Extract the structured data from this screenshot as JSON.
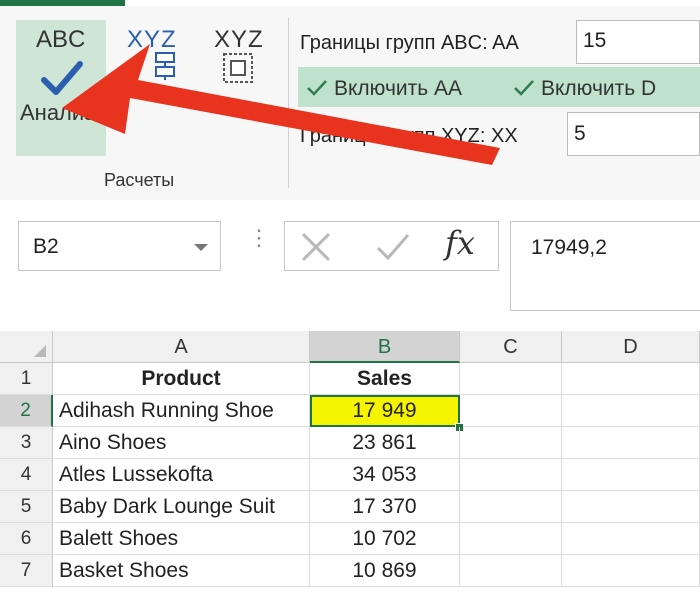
{
  "ribbon": {
    "abc_button": {
      "top_label": "ABC",
      "label": "Анализ"
    },
    "xyz_button1": {
      "label": "XYZ"
    },
    "xyz_button2": {
      "label": "XYZ"
    },
    "group_label": "Расчеты",
    "abc_bounds_label": "Границы групп ABC:  AA",
    "abc_bounds_value": "15",
    "toggle_aa": "Включить AA",
    "toggle_d": "Включить D",
    "xyz_bounds_label": "Границы групп XYZ:  XX",
    "xyz_bounds_value": "5",
    "accent_color": "#217346",
    "arrow_color": "#e8331f"
  },
  "formula_bar": {
    "name_box": "B2",
    "formula_value": "17949,2"
  },
  "sheet": {
    "columns": [
      "A",
      "B",
      "C",
      "D"
    ],
    "selected_cell": "B2",
    "rows": [
      {
        "num": "1",
        "a": "Product",
        "b": "Sales"
      },
      {
        "num": "2",
        "a": "Adihash Running Shoe",
        "b": "17 949"
      },
      {
        "num": "3",
        "a": "Aino Shoes",
        "b": "23 861"
      },
      {
        "num": "4",
        "a": "Atles Lussekofta",
        "b": "34 053"
      },
      {
        "num": "5",
        "a": "Baby Dark Lounge Suit",
        "b": "17 370"
      },
      {
        "num": "6",
        "a": "Balett Shoes",
        "b": "10 702"
      },
      {
        "num": "7",
        "a": "Basket Shoes",
        "b": "10 869"
      }
    ],
    "highlight_color": "#f5f500"
  }
}
